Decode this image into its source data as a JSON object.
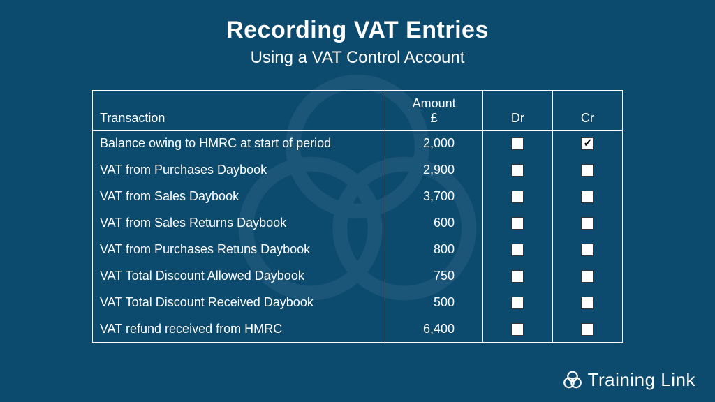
{
  "header": {
    "title": "Recording VAT Entries",
    "subtitle": "Using a VAT Control Account"
  },
  "table": {
    "columns": {
      "transaction": "Transaction",
      "amount_line1": "Amount",
      "amount_line2": "£",
      "dr": "Dr",
      "cr": "Cr"
    },
    "rows": [
      {
        "transaction": "Balance owing to HMRC at start of period",
        "amount": "2,000",
        "dr": false,
        "cr": true
      },
      {
        "transaction": "VAT from Purchases Daybook",
        "amount": "2,900",
        "dr": false,
        "cr": false
      },
      {
        "transaction": "VAT from Sales Daybook",
        "amount": "3,700",
        "dr": false,
        "cr": false
      },
      {
        "transaction": "VAT from Sales Returns Daybook",
        "amount": "600",
        "dr": false,
        "cr": false
      },
      {
        "transaction": "VAT from Purchases Retuns Daybook",
        "amount": "800",
        "dr": false,
        "cr": false
      },
      {
        "transaction": "VAT Total Discount Allowed Daybook",
        "amount": "750",
        "dr": false,
        "cr": false
      },
      {
        "transaction": "VAT Total Discount Received Daybook",
        "amount": "500",
        "dr": false,
        "cr": false
      },
      {
        "transaction": "VAT refund received from HMRC",
        "amount": "6,400",
        "dr": false,
        "cr": false
      }
    ]
  },
  "footer": {
    "brand": "Training Link"
  }
}
